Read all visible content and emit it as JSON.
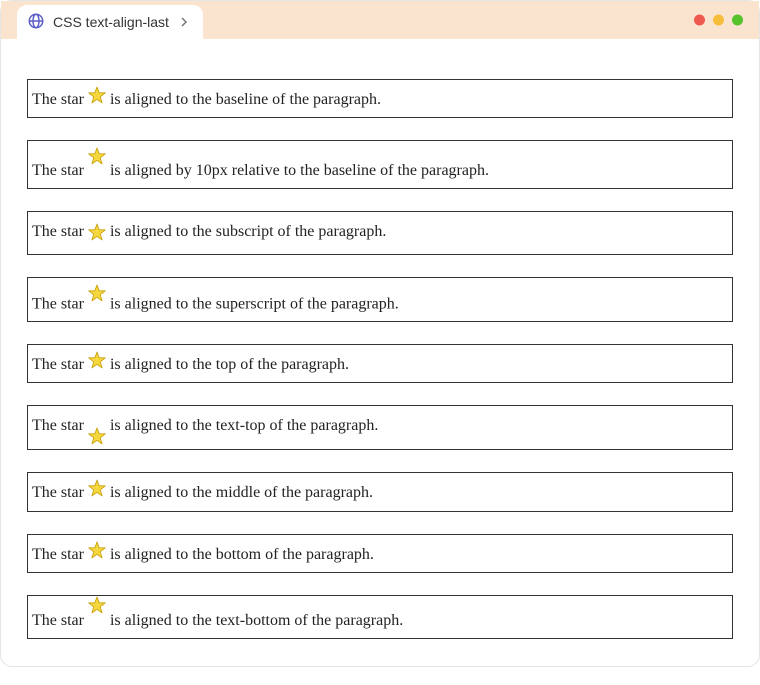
{
  "tab": {
    "title": "CSS text-align-last"
  },
  "examples": [
    {
      "prefix": "The star ",
      "suffix": " is aligned to the baseline of the paragraph.",
      "variant": "va-baseline"
    },
    {
      "prefix": "The star ",
      "suffix": " is aligned by 10px relative to the baseline of the paragraph.",
      "variant": "va-length"
    },
    {
      "prefix": "The star ",
      "suffix": " is aligned to the subscript of the paragraph.",
      "variant": "va-sub"
    },
    {
      "prefix": "The star ",
      "suffix": " is aligned to the superscript of the paragraph.",
      "variant": "va-super"
    },
    {
      "prefix": "The star ",
      "suffix": " is aligned to the top of the paragraph.",
      "variant": "va-top"
    },
    {
      "prefix": "The star ",
      "suffix": " is aligned to the text-top of the paragraph.",
      "variant": "va-text-top"
    },
    {
      "prefix": "The star ",
      "suffix": " is aligned to the middle of the paragraph.",
      "variant": "va-middle"
    },
    {
      "prefix": "The star ",
      "suffix": " is aligned to the bottom of the paragraph.",
      "variant": "va-bottom"
    },
    {
      "prefix": "The star ",
      "suffix": " is aligned to the text-bottom of the paragraph.",
      "variant": "va-text-bottom"
    }
  ]
}
